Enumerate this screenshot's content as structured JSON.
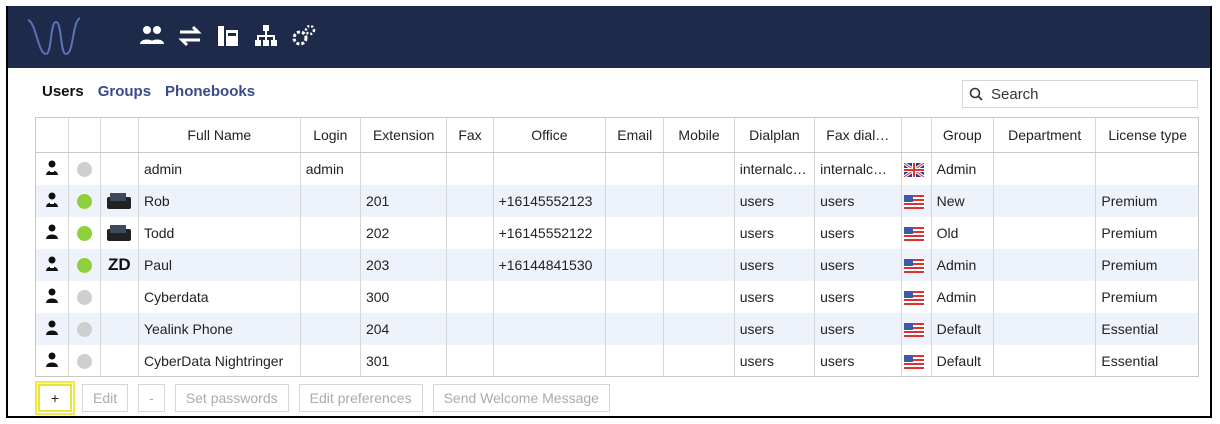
{
  "tabs": [
    {
      "label": "Users",
      "active": true
    },
    {
      "label": "Groups"
    },
    {
      "label": "Phonebooks"
    }
  ],
  "search": {
    "placeholder": "Search"
  },
  "columns": [
    "",
    "",
    "Full Name",
    "Login",
    "Extension",
    "Fax",
    "Office",
    "Email",
    "Mobile",
    "Dialplan",
    "Fax dial…",
    "",
    "Group",
    "Department",
    "License type"
  ],
  "rows": [
    {
      "presence": "off",
      "device": "",
      "name": "admin",
      "login": "admin",
      "extension": "",
      "fax": "",
      "office": "",
      "email": "",
      "mobile": "",
      "dialplan": "internalc…",
      "faxdial": "internalc…",
      "flag": "uk",
      "group": "Admin",
      "department": "",
      "license": ""
    },
    {
      "presence": "on",
      "device": "phone1",
      "name": "Rob",
      "login": "",
      "extension": "201",
      "fax": "",
      "office": "+16145552123",
      "email": "",
      "mobile": "",
      "dialplan": "users",
      "faxdial": "users",
      "flag": "us",
      "group": "New",
      "department": "",
      "license": "Premium"
    },
    {
      "presence": "on",
      "device": "phone2",
      "name": "Todd",
      "login": "",
      "extension": "202",
      "fax": "",
      "office": "+16145552122",
      "email": "",
      "mobile": "",
      "dialplan": "users",
      "faxdial": "users",
      "flag": "us",
      "group": "Old",
      "department": "",
      "license": "Premium"
    },
    {
      "presence": "on",
      "device": "ZD",
      "name": "Paul",
      "login": "",
      "extension": "203",
      "fax": "",
      "office": "+16144841530",
      "email": "",
      "mobile": "",
      "dialplan": "users",
      "faxdial": "users",
      "flag": "us",
      "group": "Admin",
      "department": "",
      "license": "Premium"
    },
    {
      "presence": "off",
      "device": "",
      "name": "Cyberdata",
      "login": "",
      "extension": "300",
      "fax": "",
      "office": "",
      "email": "",
      "mobile": "",
      "dialplan": "users",
      "faxdial": "users",
      "flag": "us",
      "group": "Admin",
      "department": "",
      "license": "Premium"
    },
    {
      "presence": "off",
      "device": "",
      "name": "Yealink Phone",
      "login": "",
      "extension": "204",
      "fax": "",
      "office": "",
      "email": "",
      "mobile": "",
      "dialplan": "users",
      "faxdial": "users",
      "flag": "us",
      "group": "Default",
      "department": "",
      "license": "Essential"
    },
    {
      "presence": "off",
      "device": "",
      "name": "CyberData Nightringer",
      "login": "",
      "extension": "301",
      "fax": "",
      "office": "",
      "email": "",
      "mobile": "",
      "dialplan": "users",
      "faxdial": "users",
      "flag": "us",
      "group": "Default",
      "department": "",
      "license": "Essential"
    }
  ],
  "buttons": {
    "add": "+",
    "edit": "Edit",
    "remove": "-",
    "set_passwords": "Set passwords",
    "edit_preferences": "Edit preferences",
    "send_welcome": "Send Welcome Message"
  },
  "colors": {
    "topbar": "#1e2a4a",
    "online": "#8cd13a",
    "offline": "#cfcfcf",
    "highlight": "#f1e94a"
  }
}
